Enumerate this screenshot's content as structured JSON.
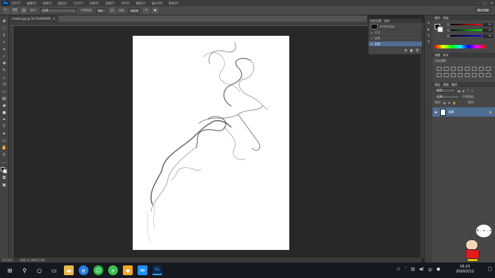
{
  "app": {
    "logo": "Ps"
  },
  "menu": {
    "items": [
      "文件(F)",
      "编辑(E)",
      "图像(I)",
      "图层(L)",
      "文字(Y)",
      "选择(S)",
      "滤镜(T)",
      "3D(D)",
      "视图(V)",
      "窗口(W)",
      "帮助(H)"
    ]
  },
  "window_controls": {
    "min": "–",
    "max": "□",
    "close": "✕"
  },
  "options": {
    "tool_size": "30",
    "mode_label": "模式:",
    "mode_value": "正常",
    "opacity_label": "不透明度:",
    "opacity_value": "8%",
    "flow_label": "流量:",
    "flow_value": "100%",
    "workspace": "基本功能"
  },
  "document": {
    "tab_title": "smoke.jpg @ 33.3%(RGB/8)",
    "zoom": "33.33%",
    "doc_info": "文档:11.1M/11.1M"
  },
  "history": {
    "tabs": [
      "历史记录",
      "动作"
    ],
    "snapshot": "smoke.jpg",
    "rows": [
      "打开",
      "拾色",
      "仿色"
    ]
  },
  "color_panel": {
    "tabs": [
      "颜色",
      "色板"
    ],
    "r_label": "R",
    "g_label": "G",
    "b_label": "B",
    "r": "20",
    "g": "17",
    "b": "16"
  },
  "adjust_panel": {
    "tabs": [
      "调整",
      "样式"
    ],
    "title": "添加调整"
  },
  "layers_panel": {
    "tabs": [
      "图层",
      "通道",
      "路径"
    ],
    "kind": "类型",
    "blend": "正常",
    "opacity_label": "不透明度:",
    "fill_label": "填充:",
    "lock_label": "锁定:",
    "layer_name": "背景"
  },
  "taskbar": {
    "time": "16:23",
    "date": "2020/2/12",
    "ime": "中"
  },
  "mascot": {
    "label": "中 ：✦ ：✦"
  }
}
